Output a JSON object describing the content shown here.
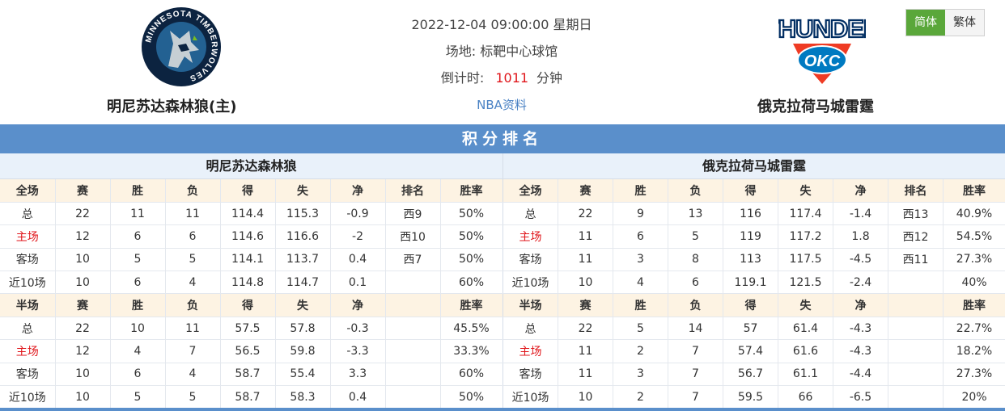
{
  "match": {
    "datetime": "2022-12-04 09:00:00 星期日",
    "venue": "场地: 标靶中心球馆",
    "countdown_label": "倒计时:",
    "countdown_value": "1011",
    "countdown_unit": "分钟",
    "info_link": "NBA资料"
  },
  "home_team": {
    "name": "明尼苏达森林狼(主)",
    "short_name": "明尼苏达森林狼",
    "logo": "minnesota-timberwolves-logo",
    "logo_ring_text": "MINNESOTA TIMBERWOLVES"
  },
  "away_team": {
    "name": "俄克拉荷马城雷霆",
    "short_name": "俄克拉荷马城雷霆",
    "logo": "okc-thunder-logo",
    "logo_wordmark": "THUNDER",
    "logo_mark": "OKC"
  },
  "lang": {
    "simplified": "简体",
    "traditional": "繁体",
    "active": "简体"
  },
  "colors": {
    "accent_green": "#5aa73a",
    "section_blue": "#5a8fcb",
    "header_tint": "#fdf3e3",
    "red": "#e0161b"
  },
  "standings": {
    "title": "积分排名",
    "home": {
      "full_header": [
        "全场",
        "赛",
        "胜",
        "负",
        "得",
        "失",
        "净",
        "排名",
        "胜率"
      ],
      "full_rows": [
        [
          "总",
          "22",
          "11",
          "11",
          "114.4",
          "115.3",
          "-0.9",
          "西9",
          "50%"
        ],
        [
          "主场",
          "12",
          "6",
          "6",
          "114.6",
          "116.6",
          "-2",
          "西10",
          "50%"
        ],
        [
          "客场",
          "10",
          "5",
          "5",
          "114.1",
          "113.7",
          "0.4",
          "西7",
          "50%"
        ],
        [
          "近10场",
          "10",
          "6",
          "4",
          "114.8",
          "114.7",
          "0.1",
          "",
          "60%"
        ]
      ],
      "half_header": [
        "半场",
        "赛",
        "胜",
        "负",
        "得",
        "失",
        "净",
        "",
        "胜率"
      ],
      "half_rows": [
        [
          "总",
          "22",
          "10",
          "11",
          "57.5",
          "57.8",
          "-0.3",
          "",
          "45.5%"
        ],
        [
          "主场",
          "12",
          "4",
          "7",
          "56.5",
          "59.8",
          "-3.3",
          "",
          "33.3%"
        ],
        [
          "客场",
          "10",
          "6",
          "4",
          "58.7",
          "55.4",
          "3.3",
          "",
          "60%"
        ],
        [
          "近10场",
          "10",
          "5",
          "5",
          "58.7",
          "58.3",
          "0.4",
          "",
          "50%"
        ]
      ]
    },
    "away": {
      "full_header": [
        "全场",
        "赛",
        "胜",
        "负",
        "得",
        "失",
        "净",
        "排名",
        "胜率"
      ],
      "full_rows": [
        [
          "总",
          "22",
          "9",
          "13",
          "116",
          "117.4",
          "-1.4",
          "西13",
          "40.9%"
        ],
        [
          "主场",
          "11",
          "6",
          "5",
          "119",
          "117.2",
          "1.8",
          "西12",
          "54.5%"
        ],
        [
          "客场",
          "11",
          "3",
          "8",
          "113",
          "117.5",
          "-4.5",
          "西11",
          "27.3%"
        ],
        [
          "近10场",
          "10",
          "4",
          "6",
          "119.1",
          "121.5",
          "-2.4",
          "",
          "40%"
        ]
      ],
      "half_header": [
        "半场",
        "赛",
        "胜",
        "负",
        "得",
        "失",
        "净",
        "",
        "胜率"
      ],
      "half_rows": [
        [
          "总",
          "22",
          "5",
          "14",
          "57",
          "61.4",
          "-4.3",
          "",
          "22.7%"
        ],
        [
          "主场",
          "11",
          "2",
          "7",
          "57.4",
          "61.6",
          "-4.3",
          "",
          "18.2%"
        ],
        [
          "客场",
          "11",
          "3",
          "7",
          "56.7",
          "61.1",
          "-4.4",
          "",
          "27.3%"
        ],
        [
          "近10场",
          "10",
          "2",
          "7",
          "59.5",
          "66",
          "-6.5",
          "",
          "20%"
        ]
      ]
    }
  }
}
